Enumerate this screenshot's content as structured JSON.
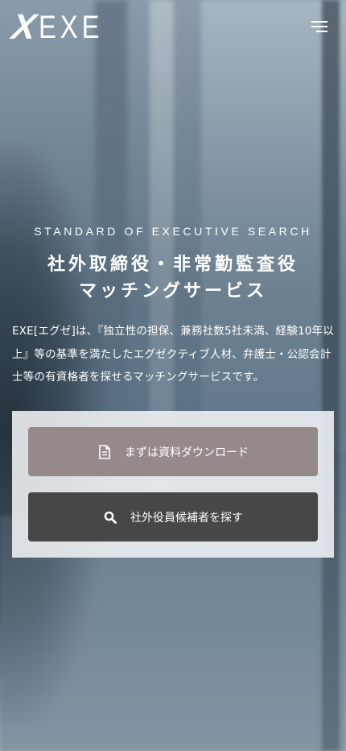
{
  "header": {
    "logo_mark": "X",
    "logo_text": "EXE",
    "menu_icon": "hamburger-menu-icon"
  },
  "hero": {
    "tagline": "STANDARD OF EXECUTIVE SEARCH",
    "headline_line1": "社外取締役・非常勤監査役",
    "headline_line2": "マッチングサービス",
    "description": "EXE[エグゼ]は、『独立性の担保、兼務社数5社未満、経験10年以上』等の基準を満たしたエグゼクティブ人材、弁護士・公認会計士等の有資格者を探せるマッチングサービスです。"
  },
  "cta": {
    "download_label": "まずは資料ダウンロード",
    "download_icon": "document-icon",
    "search_label": "社外役員候補者を探す",
    "search_icon": "search-icon"
  },
  "colors": {
    "download_button": "#958a89",
    "search_button": "#474747",
    "panel": "#f0f3f5"
  }
}
